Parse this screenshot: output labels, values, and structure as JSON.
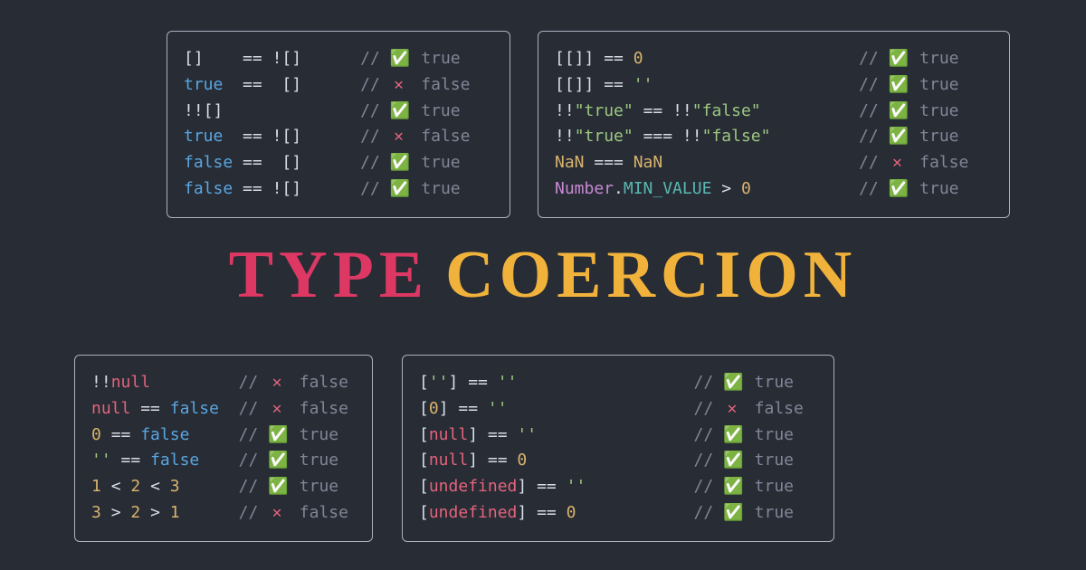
{
  "title": {
    "word1": "TYPE",
    "word2": "COERCION"
  },
  "icons": {
    "true": "✅",
    "false": "✕"
  },
  "panels": {
    "top_left": {
      "expr_pad": 18,
      "lines": [
        {
          "tokens": [
            {
              "t": "[]",
              "c": "white"
            },
            {
              "t": "    ",
              "c": "white"
            },
            {
              "t": "==",
              "c": "white"
            },
            {
              "t": " ",
              "c": "white"
            },
            {
              "t": "!",
              "c": "white"
            },
            {
              "t": "[]",
              "c": "white"
            }
          ],
          "result": true
        },
        {
          "tokens": [
            {
              "t": "true",
              "c": "blue"
            },
            {
              "t": "  ",
              "c": "white"
            },
            {
              "t": "==",
              "c": "white"
            },
            {
              "t": "  ",
              "c": "white"
            },
            {
              "t": "[]",
              "c": "white"
            }
          ],
          "result": false
        },
        {
          "tokens": [
            {
              "t": "!!",
              "c": "white"
            },
            {
              "t": "[]",
              "c": "white"
            }
          ],
          "result": true
        },
        {
          "tokens": [
            {
              "t": "true",
              "c": "blue"
            },
            {
              "t": "  ",
              "c": "white"
            },
            {
              "t": "==",
              "c": "white"
            },
            {
              "t": " ",
              "c": "white"
            },
            {
              "t": "!",
              "c": "white"
            },
            {
              "t": "[]",
              "c": "white"
            }
          ],
          "result": false
        },
        {
          "tokens": [
            {
              "t": "false",
              "c": "blue"
            },
            {
              "t": " ",
              "c": "white"
            },
            {
              "t": "==",
              "c": "white"
            },
            {
              "t": "  ",
              "c": "white"
            },
            {
              "t": "[]",
              "c": "white"
            }
          ],
          "result": true
        },
        {
          "tokens": [
            {
              "t": "false",
              "c": "blue"
            },
            {
              "t": " ",
              "c": "white"
            },
            {
              "t": "==",
              "c": "white"
            },
            {
              "t": " ",
              "c": "white"
            },
            {
              "t": "!",
              "c": "white"
            },
            {
              "t": "[]",
              "c": "white"
            }
          ],
          "result": true
        }
      ]
    },
    "top_right": {
      "expr_pad": 31,
      "lines": [
        {
          "tokens": [
            {
              "t": "[[]]",
              "c": "white"
            },
            {
              "t": " ",
              "c": "white"
            },
            {
              "t": "==",
              "c": "white"
            },
            {
              "t": " ",
              "c": "white"
            },
            {
              "t": "0",
              "c": "yellow"
            }
          ],
          "result": true
        },
        {
          "tokens": [
            {
              "t": "[[]]",
              "c": "white"
            },
            {
              "t": " ",
              "c": "white"
            },
            {
              "t": "==",
              "c": "white"
            },
            {
              "t": " ",
              "c": "white"
            },
            {
              "t": "''",
              "c": "green"
            }
          ],
          "result": true
        },
        {
          "tokens": [
            {
              "t": "!!",
              "c": "white"
            },
            {
              "t": "\"true\"",
              "c": "green"
            },
            {
              "t": " ",
              "c": "white"
            },
            {
              "t": "==",
              "c": "white"
            },
            {
              "t": " ",
              "c": "white"
            },
            {
              "t": "!!",
              "c": "white"
            },
            {
              "t": "\"false\"",
              "c": "green"
            }
          ],
          "result": true
        },
        {
          "tokens": [
            {
              "t": "!!",
              "c": "white"
            },
            {
              "t": "\"true\"",
              "c": "green"
            },
            {
              "t": " ",
              "c": "white"
            },
            {
              "t": "===",
              "c": "white"
            },
            {
              "t": " ",
              "c": "white"
            },
            {
              "t": "!!",
              "c": "white"
            },
            {
              "t": "\"false\"",
              "c": "green"
            }
          ],
          "result": true
        },
        {
          "tokens": [
            {
              "t": "NaN",
              "c": "yellow"
            },
            {
              "t": " ",
              "c": "white"
            },
            {
              "t": "===",
              "c": "white"
            },
            {
              "t": " ",
              "c": "white"
            },
            {
              "t": "NaN",
              "c": "yellow"
            }
          ],
          "result": false
        },
        {
          "tokens": [
            {
              "t": "Number",
              "c": "purple"
            },
            {
              "t": ".",
              "c": "white"
            },
            {
              "t": "MIN_VALUE",
              "c": "teal"
            },
            {
              "t": " ",
              "c": "white"
            },
            {
              "t": ">",
              "c": "white"
            },
            {
              "t": " ",
              "c": "white"
            },
            {
              "t": "0",
              "c": "yellow"
            }
          ],
          "result": true
        }
      ]
    },
    "bottom_left": {
      "expr_pad": 15,
      "lines": [
        {
          "tokens": [
            {
              "t": "!!",
              "c": "white"
            },
            {
              "t": "null",
              "c": "red"
            }
          ],
          "result": false
        },
        {
          "tokens": [
            {
              "t": "null",
              "c": "red"
            },
            {
              "t": " ",
              "c": "white"
            },
            {
              "t": "==",
              "c": "white"
            },
            {
              "t": " ",
              "c": "white"
            },
            {
              "t": "false",
              "c": "blue"
            }
          ],
          "result": false
        },
        {
          "tokens": [
            {
              "t": "0",
              "c": "yellow"
            },
            {
              "t": " ",
              "c": "white"
            },
            {
              "t": "==",
              "c": "white"
            },
            {
              "t": " ",
              "c": "white"
            },
            {
              "t": "false",
              "c": "blue"
            }
          ],
          "result": true
        },
        {
          "tokens": [
            {
              "t": "''",
              "c": "green"
            },
            {
              "t": " ",
              "c": "white"
            },
            {
              "t": "==",
              "c": "white"
            },
            {
              "t": " ",
              "c": "white"
            },
            {
              "t": "false",
              "c": "blue"
            }
          ],
          "result": true
        },
        {
          "tokens": [
            {
              "t": "1",
              "c": "yellow"
            },
            {
              "t": " ",
              "c": "white"
            },
            {
              "t": "<",
              "c": "white"
            },
            {
              "t": " ",
              "c": "white"
            },
            {
              "t": "2",
              "c": "yellow"
            },
            {
              "t": " ",
              "c": "white"
            },
            {
              "t": "<",
              "c": "white"
            },
            {
              "t": " ",
              "c": "white"
            },
            {
              "t": "3",
              "c": "yellow"
            }
          ],
          "result": true
        },
        {
          "tokens": [
            {
              "t": "3",
              "c": "yellow"
            },
            {
              "t": " ",
              "c": "white"
            },
            {
              "t": ">",
              "c": "white"
            },
            {
              "t": " ",
              "c": "white"
            },
            {
              "t": "2",
              "c": "yellow"
            },
            {
              "t": " ",
              "c": "white"
            },
            {
              "t": ">",
              "c": "white"
            },
            {
              "t": " ",
              "c": "white"
            },
            {
              "t": "1",
              "c": "yellow"
            }
          ],
          "result": false
        }
      ]
    },
    "bottom_right": {
      "expr_pad": 28,
      "lines": [
        {
          "tokens": [
            {
              "t": "[",
              "c": "white"
            },
            {
              "t": "''",
              "c": "green"
            },
            {
              "t": "]",
              "c": "white"
            },
            {
              "t": " ",
              "c": "white"
            },
            {
              "t": "==",
              "c": "white"
            },
            {
              "t": " ",
              "c": "white"
            },
            {
              "t": "''",
              "c": "green"
            }
          ],
          "result": true
        },
        {
          "tokens": [
            {
              "t": "[",
              "c": "white"
            },
            {
              "t": "0",
              "c": "yellow"
            },
            {
              "t": "]",
              "c": "white"
            },
            {
              "t": " ",
              "c": "white"
            },
            {
              "t": "==",
              "c": "white"
            },
            {
              "t": " ",
              "c": "white"
            },
            {
              "t": "''",
              "c": "green"
            }
          ],
          "result": false
        },
        {
          "tokens": [
            {
              "t": "[",
              "c": "white"
            },
            {
              "t": "null",
              "c": "red"
            },
            {
              "t": "]",
              "c": "white"
            },
            {
              "t": " ",
              "c": "white"
            },
            {
              "t": "==",
              "c": "white"
            },
            {
              "t": " ",
              "c": "white"
            },
            {
              "t": "''",
              "c": "green"
            }
          ],
          "result": true
        },
        {
          "tokens": [
            {
              "t": "[",
              "c": "white"
            },
            {
              "t": "null",
              "c": "red"
            },
            {
              "t": "]",
              "c": "white"
            },
            {
              "t": " ",
              "c": "white"
            },
            {
              "t": "==",
              "c": "white"
            },
            {
              "t": " ",
              "c": "white"
            },
            {
              "t": "0",
              "c": "yellow"
            }
          ],
          "result": true
        },
        {
          "tokens": [
            {
              "t": "[",
              "c": "white"
            },
            {
              "t": "undefined",
              "c": "red"
            },
            {
              "t": "]",
              "c": "white"
            },
            {
              "t": " ",
              "c": "white"
            },
            {
              "t": "==",
              "c": "white"
            },
            {
              "t": " ",
              "c": "white"
            },
            {
              "t": "''",
              "c": "green"
            }
          ],
          "result": true
        },
        {
          "tokens": [
            {
              "t": "[",
              "c": "white"
            },
            {
              "t": "undefined",
              "c": "red"
            },
            {
              "t": "]",
              "c": "white"
            },
            {
              "t": " ",
              "c": "white"
            },
            {
              "t": "==",
              "c": "white"
            },
            {
              "t": " ",
              "c": "white"
            },
            {
              "t": "0",
              "c": "yellow"
            }
          ],
          "result": true
        }
      ]
    }
  }
}
